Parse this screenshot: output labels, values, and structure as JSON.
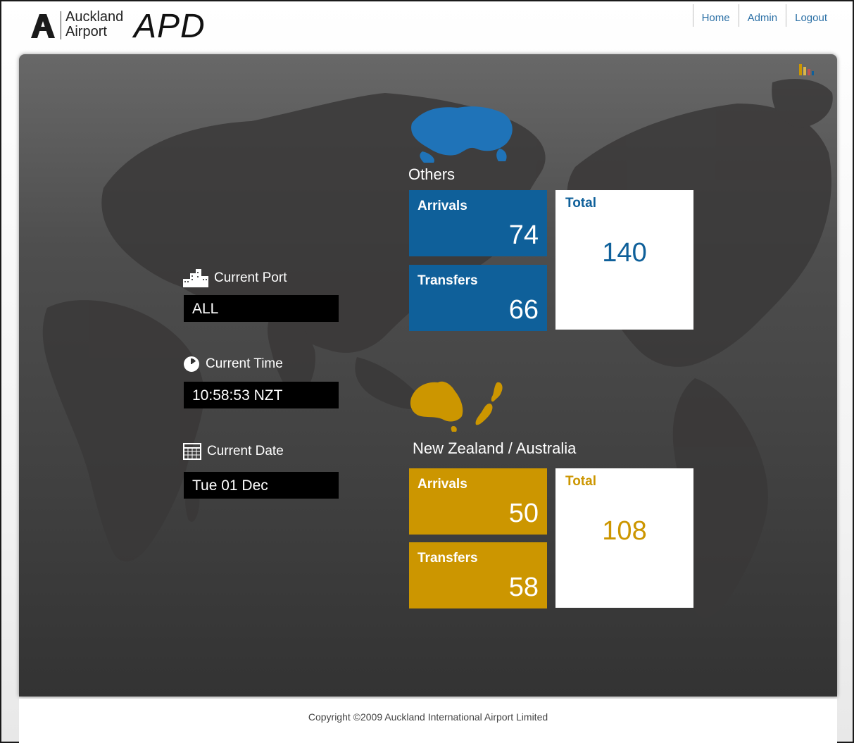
{
  "header": {
    "logo_line1": "Auckland",
    "logo_line2": "Airport",
    "app_title": "APD",
    "nav": [
      "Home",
      "Admin",
      "Logout"
    ]
  },
  "info": {
    "port_label": "Current Port",
    "port_value": "ALL",
    "time_label": "Current Time",
    "time_value": "10:58:53 NZT",
    "date_label": "Current Date",
    "date_value": "Tue 01 Dec"
  },
  "regions": [
    {
      "title": "Others",
      "arrivals_label": "Arrivals",
      "arrivals": "74",
      "transfers_label": "Transfers",
      "transfers": "66",
      "total_label": "Total",
      "total": "140",
      "color": "#0f609a"
    },
    {
      "title": "New Zealand / Australia",
      "arrivals_label": "Arrivals",
      "arrivals": "50",
      "transfers_label": "Transfers",
      "transfers": "58",
      "total_label": "Total",
      "total": "108",
      "color": "#cc9600"
    }
  ],
  "footer": {
    "copyright": "Copyright ©2009 Auckland International Airport Limited"
  },
  "icons": [
    "airport-logo-icon",
    "bar-chart-icon",
    "buildings-icon",
    "clock-icon",
    "calendar-icon",
    "world-map",
    "world-globe-icon",
    "nz-australia-map-icon"
  ]
}
